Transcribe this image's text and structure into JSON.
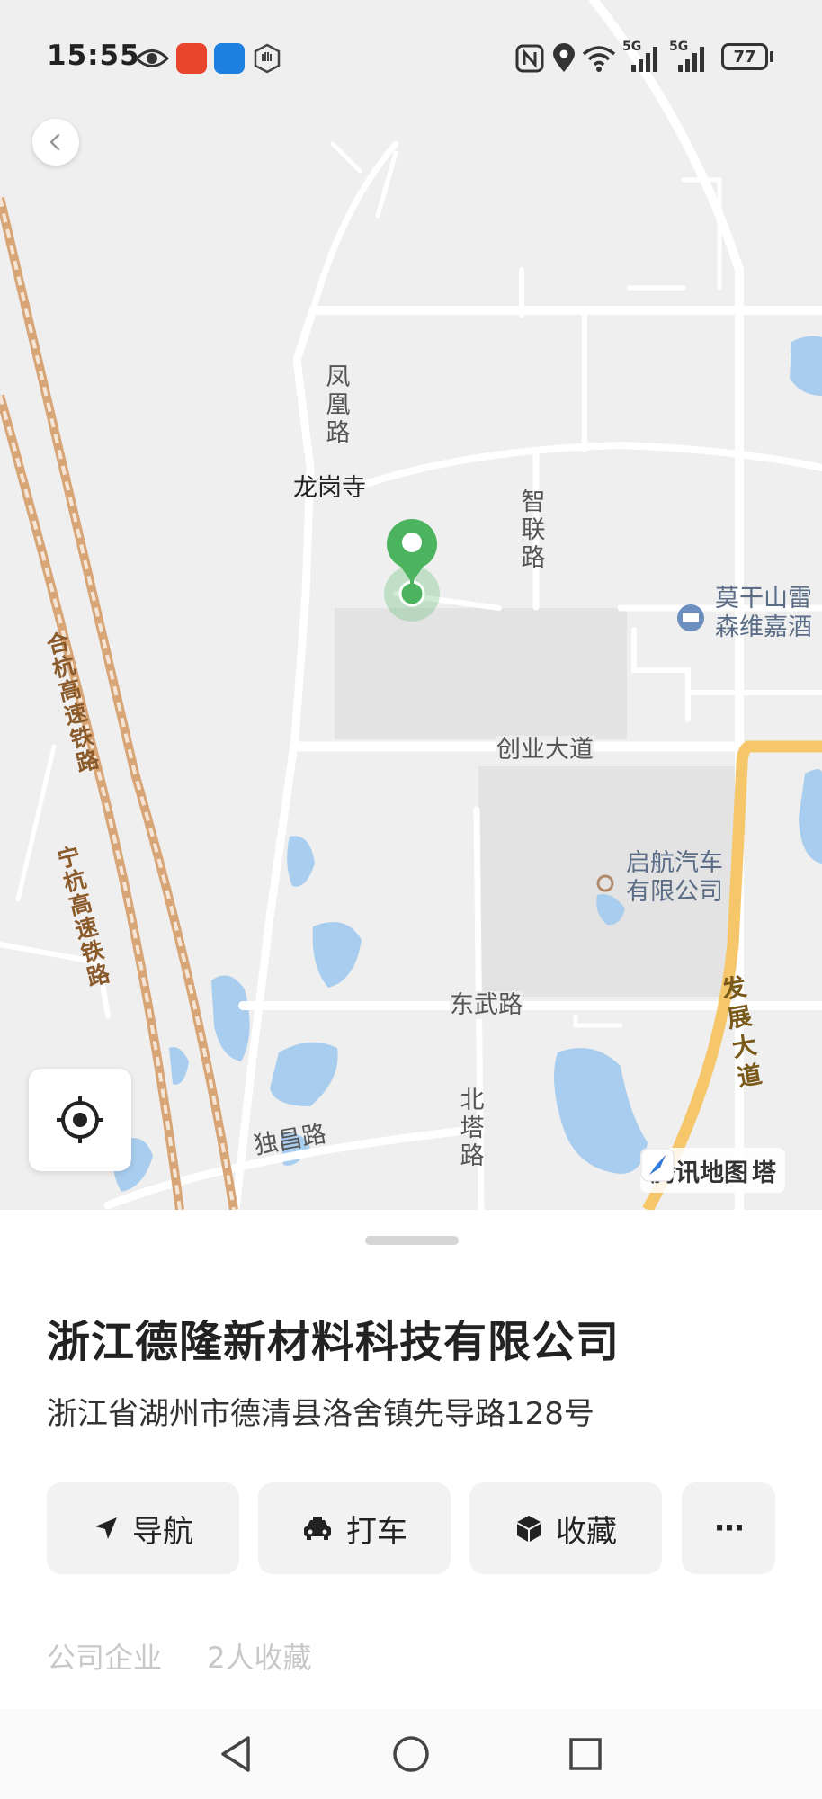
{
  "status_bar": {
    "time": "15:55",
    "battery": "77",
    "network_1": "5G",
    "network_2": "5G",
    "icons": [
      "eye-icon",
      "taobao-app-icon",
      "browser-app-icon",
      "hand-icon",
      "nfc-icon",
      "location-icon",
      "wifi-icon",
      "signal-icon",
      "signal-icon",
      "battery-icon"
    ]
  },
  "map": {
    "road_labels": {
      "fenghuang": "凤凰路",
      "zhilian": "智联路",
      "chuangye": "创业大道",
      "dongwu": "东武路",
      "dudchang": "独昌路",
      "beita": "北塔路",
      "fazhan": "发展大道",
      "hehang": "合杭高速铁路",
      "ninghang": "宁杭高速铁路"
    },
    "place_labels": {
      "temple": "龙岗寺",
      "hotel": "莫干山雷\n森维嘉酒",
      "company_poi": "启航汽车\n有限公司"
    },
    "watermark": "腾讯地图",
    "watermark_suffix": "塔",
    "marker_color": "#4CB45E",
    "accent_highway": "#F5C76A"
  },
  "place": {
    "name": "浙江德隆新材料科技有限公司",
    "address": "浙江省湖州市德清县洛舍镇先导路128号",
    "category": "公司企业",
    "favorites": "2人收藏"
  },
  "actions": [
    {
      "label": "导航",
      "icon": "navigation-arrow-icon"
    },
    {
      "label": "打车",
      "icon": "taxi-icon"
    },
    {
      "label": "收藏",
      "icon": "cube-icon"
    },
    {
      "label": "···",
      "icon": "more-icon"
    }
  ],
  "nav_bar": {
    "buttons": [
      "back-triangle-icon",
      "home-circle-icon",
      "recents-square-icon"
    ]
  }
}
